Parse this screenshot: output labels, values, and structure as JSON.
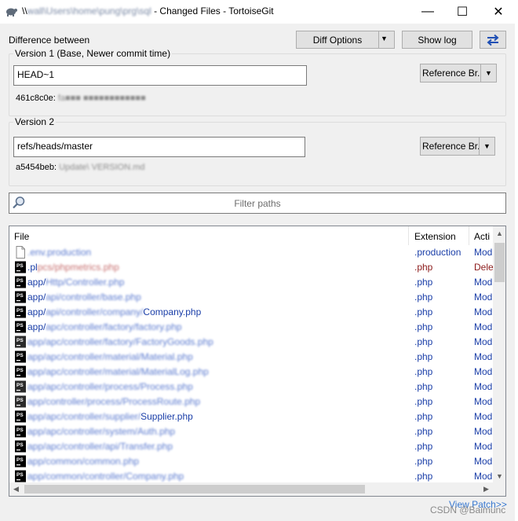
{
  "window": {
    "title_prefix": "\\\\",
    "title_path": "wall\\Users\\home\\pung\\prg\\sql",
    "title_suffix": " - Changed Files - TortoiseGit",
    "minimize": "—",
    "maximize": "☐",
    "close": "✕"
  },
  "header": {
    "difference_between": "Difference between",
    "diff_options": "Diff Options",
    "show_log": "Show log",
    "swap_icon": "swap-arrows-icon"
  },
  "version1": {
    "group_title": "Version 1 (Base, Newer commit time)",
    "value": "HEAD~1",
    "ref_button": "Reference Br...",
    "hash": "461c8c0e: ",
    "hash_msg": "fa■■■ ■■■■■■■■■■■■"
  },
  "version2": {
    "group_title": "Version 2",
    "value": "refs/heads/master",
    "ref_button": "Reference Br...",
    "hash": "a5454beb: ",
    "hash_msg": "Update\\ VERSION.md"
  },
  "filter": {
    "placeholder": "Filter paths"
  },
  "columns": {
    "file": "File",
    "extension": "Extension",
    "action": "Acti"
  },
  "files": [
    {
      "prefix": "",
      "hidden": ".env.production",
      "suffix": "",
      "ext": ".production",
      "action": "Mod",
      "icon": "blank-file-icon",
      "deleted": false
    },
    {
      "prefix": ".pl",
      "hidden": "pcs/phpmetrics.php",
      "suffix": "",
      "ext": ".php",
      "action": "Dele",
      "icon": "phpstorm-file-icon",
      "deleted": true
    },
    {
      "prefix": "app/",
      "hidden": "Http/Controller.php",
      "suffix": "",
      "ext": ".php",
      "action": "Mod",
      "icon": "phpstorm-file-icon",
      "deleted": false
    },
    {
      "prefix": "app/",
      "hidden": "api/controller/base.php",
      "suffix": "",
      "ext": ".php",
      "action": "Mod",
      "icon": "phpstorm-file-icon",
      "deleted": false
    },
    {
      "prefix": "app/",
      "hidden": "api/controller/company/",
      "suffix": "Company.php",
      "ext": ".php",
      "action": "Mod",
      "icon": "phpstorm-file-icon",
      "deleted": false
    },
    {
      "prefix": "app/",
      "hidden": "apc/controller/factory/factory.php",
      "suffix": "",
      "ext": ".php",
      "action": "Mod",
      "icon": "phpstorm-file-icon",
      "deleted": false
    },
    {
      "prefix": "",
      "hidden": "app/apc/controller/factory/FactoryGoods.php",
      "suffix": "",
      "ext": ".php",
      "action": "Mod",
      "icon": "phpstorm-dark-icon",
      "deleted": false
    },
    {
      "prefix": "",
      "hidden": "app/apc/controller/material/Material.php",
      "suffix": "",
      "ext": ".php",
      "action": "Mod",
      "icon": "phpstorm-file-icon",
      "deleted": false
    },
    {
      "prefix": "",
      "hidden": "app/apc/controller/material/MaterialLog.php",
      "suffix": "",
      "ext": ".php",
      "action": "Mod",
      "icon": "phpstorm-file-icon",
      "deleted": false
    },
    {
      "prefix": "",
      "hidden": "app/apc/controller/process/Process.php",
      "suffix": "",
      "ext": ".php",
      "action": "Mod",
      "icon": "phpstorm-dark-icon",
      "deleted": false
    },
    {
      "prefix": "",
      "hidden": "app/controller/process/ProcessRoute.php",
      "suffix": "",
      "ext": ".php",
      "action": "Mod",
      "icon": "phpstorm-dark-icon",
      "deleted": false
    },
    {
      "prefix": "",
      "hidden": "app/apc/controller/supplier/",
      "suffix": "Supplier.php",
      "ext": ".php",
      "action": "Mod",
      "icon": "phpstorm-file-icon",
      "deleted": false
    },
    {
      "prefix": "",
      "hidden": "app/apc/controller/system/Auth.php",
      "suffix": "",
      "ext": ".php",
      "action": "Mod",
      "icon": "phpstorm-file-icon",
      "deleted": false
    },
    {
      "prefix": "",
      "hidden": "app/apc/controller/api/Transfer.php",
      "suffix": "",
      "ext": ".php",
      "action": "Mod",
      "icon": "phpstorm-file-icon",
      "deleted": false
    },
    {
      "prefix": "",
      "hidden": "app/common/common.php",
      "suffix": "",
      "ext": ".php",
      "action": "Mod",
      "icon": "phpstorm-file-icon",
      "deleted": false
    },
    {
      "prefix": "",
      "hidden": "app/common/controller/Company.php",
      "suffix": "",
      "ext": ".php",
      "action": "Mod",
      "icon": "phpstorm-file-icon",
      "deleted": false
    }
  ],
  "footer": {
    "view_patch": "View Patch>>",
    "watermark": "CSDN @Baimunc"
  },
  "colors": {
    "link": "#1a3ea8",
    "deleted": "#8b1a1a",
    "window_bg": "#f0f0f0",
    "swap_icon": "#1f4fb4"
  }
}
